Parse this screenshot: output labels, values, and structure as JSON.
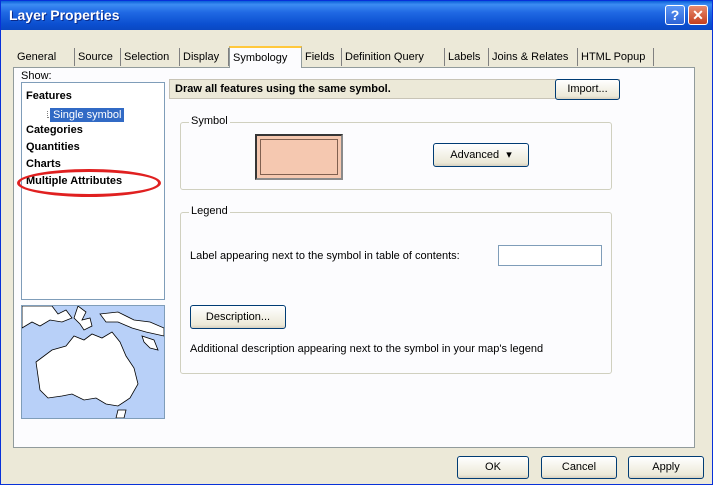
{
  "window": {
    "title": "Layer Properties",
    "help_glyph": "?",
    "close_glyph": "✕"
  },
  "tabs": [
    {
      "label": "General"
    },
    {
      "label": "Source"
    },
    {
      "label": "Selection"
    },
    {
      "label": "Display"
    },
    {
      "label": "Symbology",
      "active": true
    },
    {
      "label": "Fields"
    },
    {
      "label": "Definition Query"
    },
    {
      "label": "Labels"
    },
    {
      "label": "Joins & Relates"
    },
    {
      "label": "HTML Popup"
    }
  ],
  "show": {
    "label": "Show:",
    "items": [
      {
        "label": "Features"
      },
      {
        "label": "Single symbol",
        "selected": true
      },
      {
        "label": "Categories"
      },
      {
        "label": "Quantities"
      },
      {
        "label": "Charts"
      },
      {
        "label": "Multiple Attributes",
        "highlighted": true
      }
    ]
  },
  "header": {
    "description": "Draw all features using the same symbol.",
    "import_label": "Import..."
  },
  "symbol": {
    "group_title": "Symbol",
    "fill_color": "#f5c8b0",
    "advanced_label": "Advanced",
    "advanced_arrow": "▾"
  },
  "legend": {
    "group_title": "Legend",
    "label_caption": "Label appearing next to the symbol in table of contents:",
    "label_value": "",
    "description_button": "Description...",
    "description_caption": "Additional description appearing next to the symbol in your map's legend"
  },
  "footer": {
    "ok_label": "OK",
    "cancel_label": "Cancel",
    "apply_label": "Apply"
  },
  "colors": {
    "titlebar": "#0a5fd8",
    "selection": "#316ac5",
    "annotation": "#e02020",
    "symbol_fill": "#f5c8b0"
  }
}
